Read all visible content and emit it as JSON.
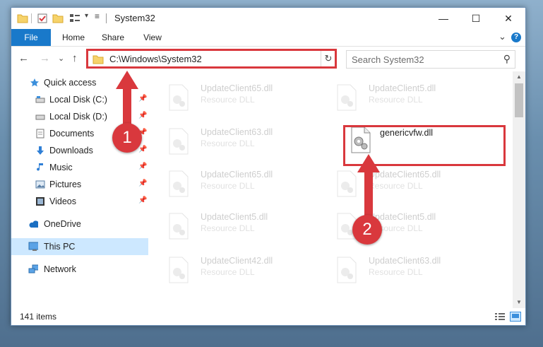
{
  "window": {
    "title": "System32",
    "controls": {
      "minimize": "—",
      "maximize": "☐",
      "close": "✕"
    }
  },
  "ribbon": {
    "tabs": [
      {
        "label": "File",
        "active": true
      },
      {
        "label": "Home"
      },
      {
        "label": "Share"
      },
      {
        "label": "View"
      }
    ],
    "expand_glyph": "⌄",
    "help_glyph": "?"
  },
  "address_bar": {
    "path": "C:\\Windows\\System32",
    "dropdown_glyph": "⌄",
    "refresh_glyph": "↻"
  },
  "search": {
    "placeholder": "Search System32",
    "icon": "search-icon"
  },
  "nav": {
    "back": "←",
    "forward": "→",
    "recent": "⌄",
    "up": "↑",
    "items": [
      {
        "label": "Quick access",
        "icon": "star-icon",
        "pinned": false
      },
      {
        "label": "Local Disk (C:)",
        "icon": "drive-icon",
        "pinned": true
      },
      {
        "label": "Local Disk (D:)",
        "icon": "drive-icon",
        "pinned": true
      },
      {
        "label": "Documents",
        "icon": "documents-icon",
        "pinned": true
      },
      {
        "label": "Downloads",
        "icon": "download-icon",
        "pinned": true
      },
      {
        "label": "Music",
        "icon": "music-icon",
        "pinned": true
      },
      {
        "label": "Pictures",
        "icon": "pictures-icon",
        "pinned": true
      },
      {
        "label": "Videos",
        "icon": "videos-icon",
        "pinned": true
      },
      {
        "label": "OneDrive",
        "icon": "cloud-icon",
        "pinned": false
      },
      {
        "label": "This PC",
        "icon": "computer-icon",
        "pinned": false,
        "selected": true
      },
      {
        "label": "Network",
        "icon": "network-icon",
        "pinned": false
      }
    ]
  },
  "files": [
    {
      "name": "UpdateClient65.dll",
      "type": "Resource DLL",
      "highlighted": false
    },
    {
      "name": "UpdateClient5.dll",
      "type": "Resource DLL",
      "highlighted": false
    },
    {
      "name": "UpdateClient63.dll",
      "type": "Resource DLL",
      "highlighted": false
    },
    {
      "name": "genericvfw.dll",
      "type": "",
      "highlighted": true
    },
    {
      "name": "UpdateClient65.dll",
      "type": "Resource DLL",
      "highlighted": false
    },
    {
      "name": "UpdateClient65.dll",
      "type": "Resource DLL",
      "highlighted": false
    },
    {
      "name": "UpdateClient5.dll",
      "type": "Resource DLL",
      "highlighted": false
    },
    {
      "name": "UpdateClient5.dll",
      "type": "Resource DLL",
      "highlighted": false
    },
    {
      "name": "UpdateClient42.dll",
      "type": "Resource DLL",
      "highlighted": false
    },
    {
      "name": "UpdateClient63.dll",
      "type": "Resource DLL",
      "highlighted": false
    }
  ],
  "status": {
    "item_count": "141 items"
  },
  "callouts": [
    {
      "label": "1"
    },
    {
      "label": "2"
    }
  ],
  "colors": {
    "accent": "#1979ca",
    "annotation": "#d9383d",
    "selected": "#cde8ff"
  }
}
